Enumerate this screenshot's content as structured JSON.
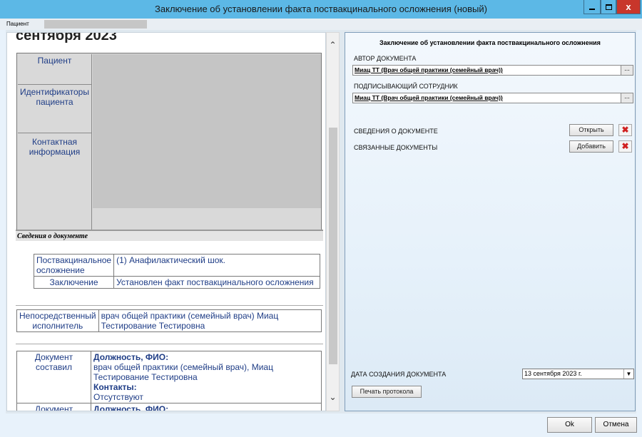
{
  "window": {
    "title": "Заключение об установлении факта поствакцинального осложнения (новый)",
    "close_glyph": "x"
  },
  "patient_bar": {
    "label": "Пациент"
  },
  "document": {
    "heading": "сентября 2023",
    "patient_labels": [
      "Пациент",
      "Идентификаторы пациента",
      "Контактная информация"
    ],
    "section_title": "Сведения о документе",
    "details_rows": [
      {
        "label": "Поствакцинальное осложнение",
        "value": "(1) Анафилактический шок."
      },
      {
        "label": "Заключение",
        "value": "Установлен факт поствакцинального осложнения"
      }
    ],
    "executor": {
      "label": "Непосредственный исполнитель",
      "value": "врач общей практики (семейный врач) Миац Тестирование Тестировна"
    },
    "composed": {
      "label": "Документ составил",
      "h1": "Должность, ФИО:",
      "v1": "врач общей практики (семейный врач), Миац Тестирование Тестировна",
      "h2": "Контакты:",
      "v2": "Отсутствуют"
    },
    "certified": {
      "label": "Документ заверил",
      "h1": "Должность, ФИО:"
    }
  },
  "panel": {
    "title": "Заключение об установлении факта поствакцинального осложнения",
    "author_label": "АВТОР ДОКУМЕНТА",
    "author_value": "Миац ТТ (Врач общей практики (семейный врач))",
    "signer_label": "ПОДПИСЫВАЮЩИЙ СОТРУДНИК",
    "signer_value": "Миац ТТ (Врач общей практики (семейный врач))",
    "browse_label": "...",
    "doc_info_label": "СВЕДЕНИЯ О ДОКУМЕНТЕ",
    "open_button": "Открыть",
    "related_label": "СВЯЗАННЫЕ ДОКУМЕНТЫ",
    "add_button": "Добавить",
    "created_label": "ДАТА СОЗДАНИЯ ДОКУМЕНТА",
    "created_value": "13 сентября 2023 г.",
    "print_button": "Печать протокола"
  },
  "footer": {
    "ok": "Ok",
    "cancel": "Отмена"
  },
  "colors": {
    "titlebar": "#5cb8e6",
    "close": "#c8362b",
    "link_text": "#1f3d86",
    "delete_icon": "#d02020"
  }
}
